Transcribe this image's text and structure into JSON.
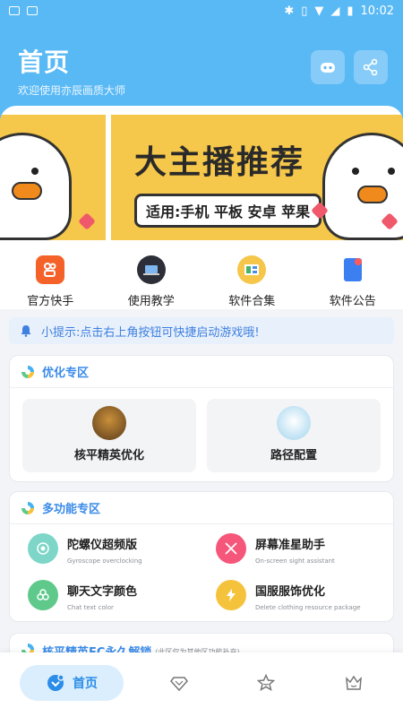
{
  "status_bar": {
    "time": "10:02"
  },
  "header": {
    "title": "首页",
    "subtitle": "欢迎使用亦辰画质大师",
    "game_icon": "gamepad-icon",
    "share_icon": "share-icon"
  },
  "banner": {
    "title": "大主播推荐",
    "tag": "适用:手机 平板 安卓 苹果"
  },
  "quick_actions": [
    {
      "label": "官方快手",
      "icon": "kuaishou-icon"
    },
    {
      "label": "使用教学",
      "icon": "laptop-icon"
    },
    {
      "label": "软件合集",
      "icon": "collection-icon"
    },
    {
      "label": "软件公告",
      "icon": "announcement-icon"
    }
  ],
  "tip": {
    "text": "小提示:点击右上角按钮可快捷启动游戏哦!",
    "icon": "bell-icon"
  },
  "optimize": {
    "title": "优化专区",
    "items": [
      {
        "label": "核平精英优化"
      },
      {
        "label": "路径配置"
      }
    ]
  },
  "multi": {
    "title": "多功能专区",
    "items": [
      {
        "title": "陀螺仪超频版",
        "subtitle": "Gyroscope overclocking",
        "color": "#7dd6c8"
      },
      {
        "title": "屏幕准星助手",
        "subtitle": "On-screen sight assistant",
        "color": "#f5567a"
      },
      {
        "title": "聊天文字颜色",
        "subtitle": "Chat text color",
        "color": "#5ec98a"
      },
      {
        "title": "国服服饰优化",
        "subtitle": "Delete clothing resource package",
        "color": "#f5c33b"
      }
    ]
  },
  "section3": {
    "title": "核平精英FC永久解锁",
    "subtitle": "(此区仅为其他区功能补充)"
  },
  "bottom_nav": {
    "home_label": "首页",
    "items": [
      "home-icon",
      "diamond-icon",
      "star-icon",
      "crown-icon"
    ]
  },
  "colors": {
    "primary": "#59b9f5",
    "accent": "#3a8be8"
  }
}
